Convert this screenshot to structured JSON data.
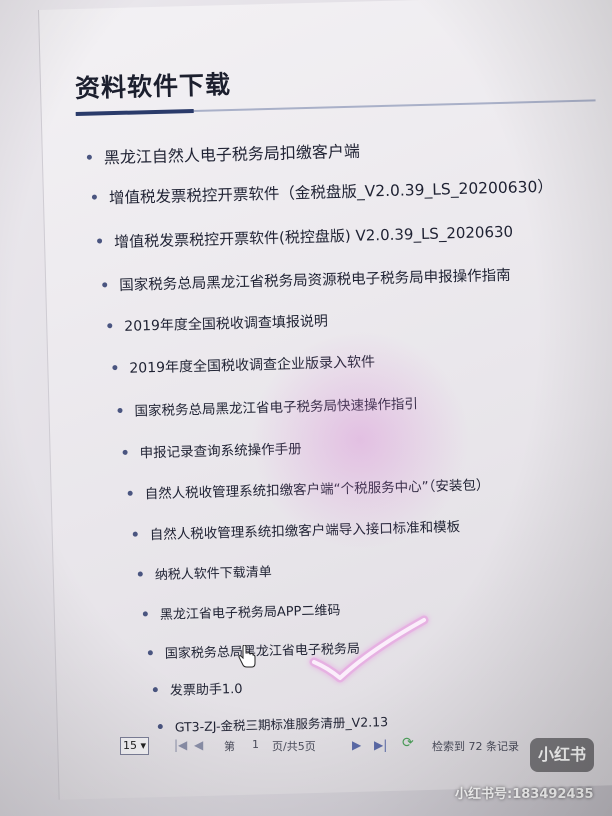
{
  "page": {
    "title": "资料软件下载"
  },
  "downloads": [
    {
      "label": "黑龙江自然人电子税务局扣缴客户端"
    },
    {
      "label": "增值税发票税控开票软件（金税盘版_V2.0.39_LS_20200630）"
    },
    {
      "label": "增值税发票税控开票软件(税控盘版) V2.0.39_LS_2020630"
    },
    {
      "label": "国家税务总局黑龙江省税务局资源税电子税务局申报操作指南"
    },
    {
      "label": "2019年度全国税收调查填报说明"
    },
    {
      "label": "2019年度全国税收调查企业版录入软件"
    },
    {
      "label": "国家税务总局黑龙江省电子税务局快速操作指引"
    },
    {
      "label": "申报记录查询系统操作手册"
    },
    {
      "label": "自然人税收管理系统扣缴客户端“个税服务中心”（安装包）"
    },
    {
      "label": "自然人税收管理系统扣缴客户端导入接口标准和模板"
    },
    {
      "label": "纳税人软件下载清单"
    },
    {
      "label": "黑龙江省电子税务局APP二维码"
    },
    {
      "label": "国家税务总局黑龙江省电子税务局"
    },
    {
      "label": "发票助手1.0"
    },
    {
      "label": "GT3-ZJ-金税三期标准服务清册_V2.13"
    }
  ],
  "pagination": {
    "page_size": "15",
    "first": "|◀",
    "prev": "◀",
    "label_di": "第",
    "current_page": "1",
    "label_of": "页/共5页",
    "next": "▶",
    "last": "▶|",
    "refresh": "⟳",
    "summary": "检索到 72 条记录"
  },
  "watermark": {
    "logo": "小红书",
    "id": "小红书号:183492435"
  },
  "colors": {
    "title": "#1c1f2e",
    "link": "#1f2233",
    "accent": "#2a3a6a",
    "check_mark": "#f0e6f4"
  },
  "icons": {
    "bullet": "bullet-dot-icon",
    "cursor": "hand-pointer-icon",
    "refresh": "refresh-icon",
    "check": "checkmark-icon"
  }
}
